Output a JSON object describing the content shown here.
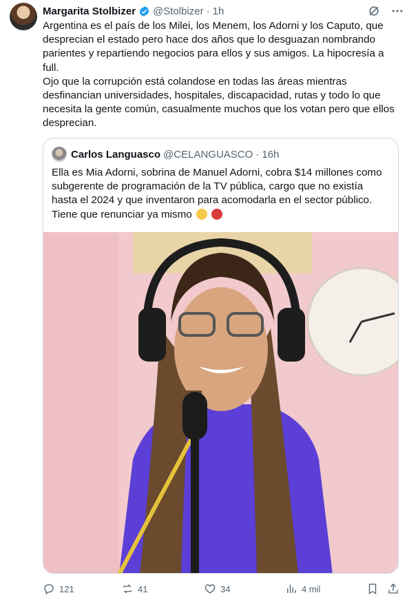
{
  "tweet": {
    "author_name": "Margarita Stolbizer",
    "author_handle": "@Stolbizer",
    "separator": "·",
    "time": "1h",
    "paragraph1": "Argentina es el país de los Milei, los Menem, los Adorni y los Caputo, que desprecian el estado pero hace dos años que lo desguazan nombrando parientes y repartiendo negocios para ellos y sus amigos. La hipocresía a full.",
    "paragraph2": "Ojo que la corrupción está colandose en todas las áreas mientras desfinancian universidades, hospitales, discapacidad, rutas y todo lo que necesita la gente común, casualmente muchos que los votan pero que ellos desprecian."
  },
  "quote": {
    "author_name": "Carlos Languasco",
    "author_handle": "@CELANGUASCO",
    "separator": "·",
    "time": "16h",
    "text": "Ella es Mia Adorni, sobrina de Manuel Adorni, cobra $14 millones como subgerente de programación de la TV pública, cargo que no existía hasta el 2024 y que inventaron para acomodarla en el sector público. Tiene que renunciar ya mismo"
  },
  "actions": {
    "replies": "121",
    "reposts": "41",
    "likes": "34",
    "views": "4 mil"
  },
  "icons": {
    "verified": "verified-badge-icon",
    "grok": "grok-icon",
    "more": "more-icon",
    "reply": "reply-icon",
    "repost": "repost-icon",
    "like": "like-icon",
    "views": "views-icon",
    "bookmark": "bookmark-icon",
    "share": "share-icon"
  },
  "colors": {
    "accent": "#1d9bf0",
    "secondary_text": "#536471",
    "border": "#cfd9de"
  }
}
